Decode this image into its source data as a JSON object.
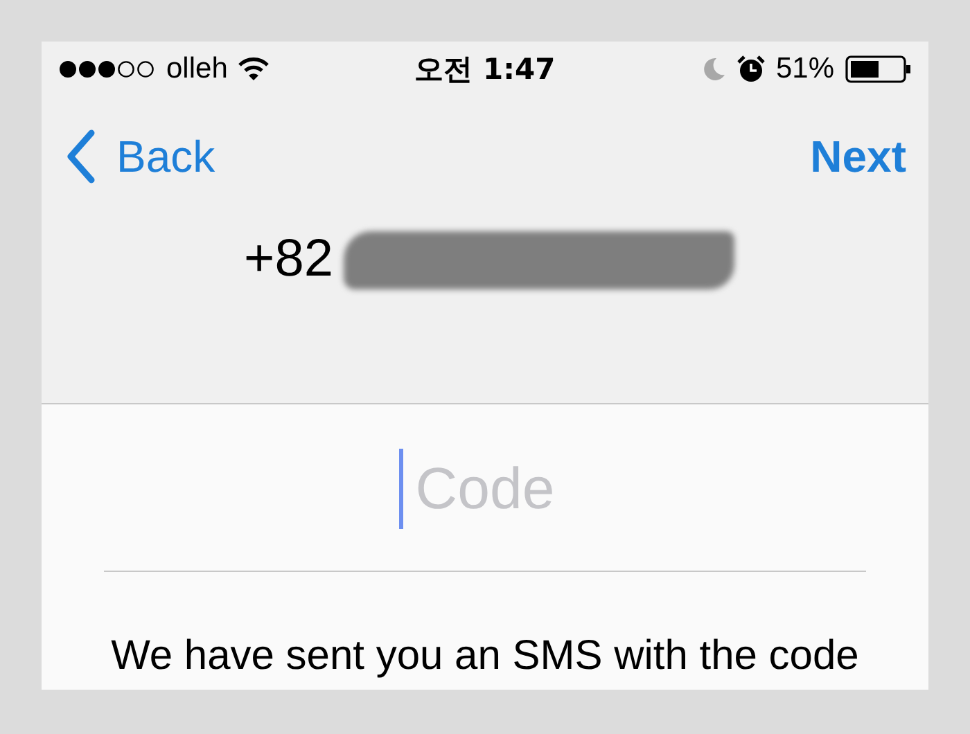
{
  "status_bar": {
    "carrier": "olleh",
    "time": "오전 1:47",
    "battery": "51%"
  },
  "nav": {
    "back": "Back",
    "next": "Next"
  },
  "phone": {
    "prefix": "+82"
  },
  "code_field": {
    "placeholder": "Code"
  },
  "message": "We have sent you an SMS with the code"
}
